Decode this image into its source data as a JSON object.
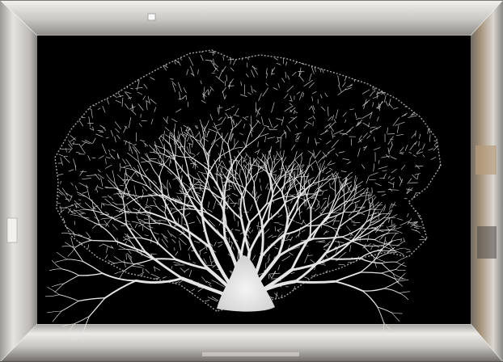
{
  "artwork": {
    "subject": "sea-fan-coral-icon",
    "colors": {
      "background": "#000000",
      "coral": "#e4e4e4",
      "mirror_light": "#e9e7e3",
      "mirror_dark": "#8f8c88"
    }
  }
}
